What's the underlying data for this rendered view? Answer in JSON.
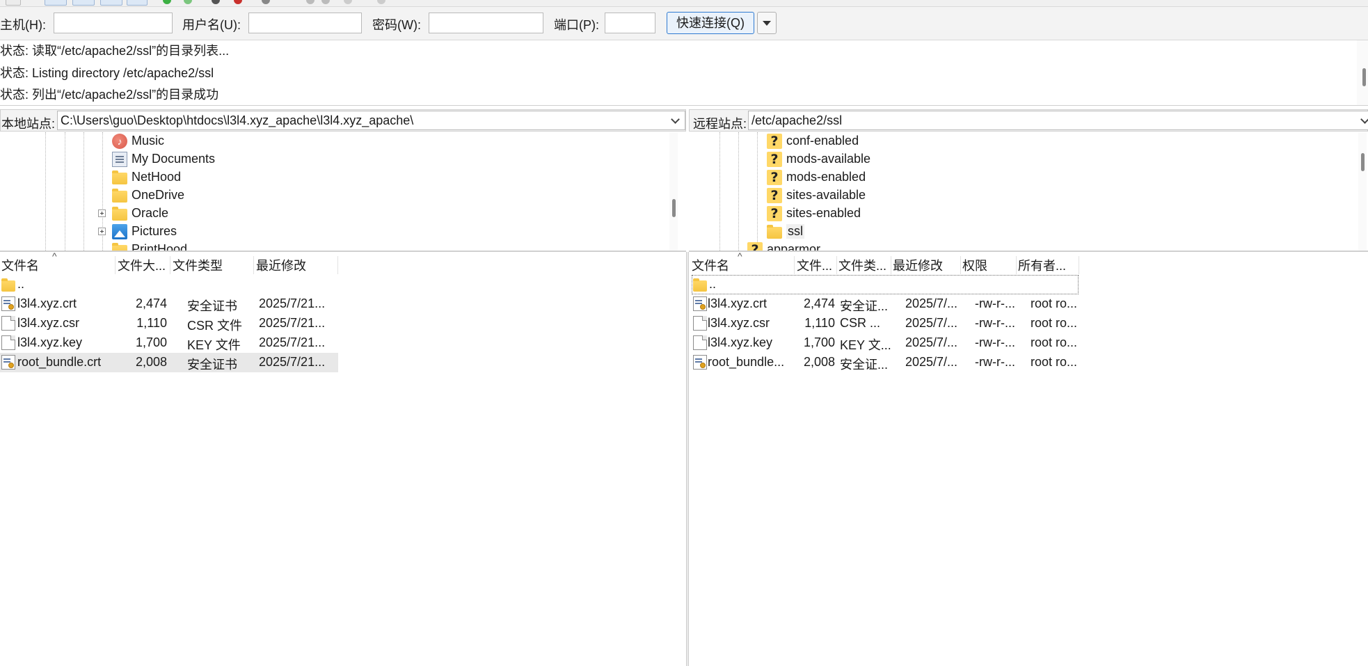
{
  "quickconnect": {
    "host_label": "主机(H):",
    "host_value": "",
    "user_label": "用户名(U):",
    "user_value": "",
    "pass_label": "密码(W):",
    "pass_value": "",
    "port_label": "端口(P):",
    "port_value": "",
    "connect_label": "快速连接(Q)"
  },
  "log": [
    "状态: 读取“/etc/apache2/ssl”的目录列表...",
    "状态: Listing directory /etc/apache2/ssl",
    "状态: 列出“/etc/apache2/ssl”的目录成功"
  ],
  "local": {
    "site_label": "本地站点:",
    "path": "C:\\Users\\guo\\Desktop\\htdocs\\l3l4.xyz_apache\\l3l4.xyz_apache\\",
    "tree": [
      {
        "label": "Music",
        "icon": "music-icon",
        "expandable": false
      },
      {
        "label": "My Documents",
        "icon": "documents-icon",
        "expandable": false
      },
      {
        "label": "NetHood",
        "icon": "folder-icon",
        "expandable": false
      },
      {
        "label": "OneDrive",
        "icon": "folder-icon",
        "expandable": false
      },
      {
        "label": "Oracle",
        "icon": "folder-icon",
        "expandable": true
      },
      {
        "label": "Pictures",
        "icon": "pictures-icon",
        "expandable": true
      },
      {
        "label": "PrintHood",
        "icon": "folder-icon",
        "expandable": false
      }
    ],
    "columns": [
      "文件名",
      "文件大...",
      "文件类型",
      "最近修改"
    ],
    "files": [
      {
        "name": "..",
        "size": "",
        "type": "",
        "modified": "",
        "icon": "folder-icon"
      },
      {
        "name": "l3l4.xyz.crt",
        "size": "2,474",
        "type": "安全证书",
        "modified": "2025/7/21...",
        "icon": "certificate-icon"
      },
      {
        "name": "l3l4.xyz.csr",
        "size": "1,110",
        "type": "CSR 文件",
        "modified": "2025/7/21...",
        "icon": "file-icon"
      },
      {
        "name": "l3l4.xyz.key",
        "size": "1,700",
        "type": "KEY 文件",
        "modified": "2025/7/21...",
        "icon": "file-icon"
      },
      {
        "name": "root_bundle.crt",
        "size": "2,008",
        "type": "安全证书",
        "modified": "2025/7/21...",
        "icon": "certificate-icon"
      }
    ]
  },
  "remote": {
    "site_label": "远程站点:",
    "path": "/etc/apache2/ssl",
    "tree": [
      {
        "label": "conf-enabled",
        "icon": "question-folder-icon"
      },
      {
        "label": "mods-available",
        "icon": "question-folder-icon"
      },
      {
        "label": "mods-enabled",
        "icon": "question-folder-icon"
      },
      {
        "label": "sites-available",
        "icon": "question-folder-icon"
      },
      {
        "label": "sites-enabled",
        "icon": "question-folder-icon"
      },
      {
        "label": "ssl",
        "icon": "folder-icon"
      },
      {
        "label": "apparmor",
        "icon": "question-folder-icon"
      }
    ],
    "columns": [
      "文件名",
      "文件...",
      "文件类...",
      "最近修改",
      "权限",
      "所有者..."
    ],
    "files": [
      {
        "name": "..",
        "size": "",
        "type": "",
        "modified": "",
        "perm": "",
        "owner": "",
        "icon": "folder-icon"
      },
      {
        "name": "l3l4.xyz.crt",
        "size": "2,474",
        "type": "安全证...",
        "modified": "2025/7/...",
        "perm": "-rw-r-...",
        "owner": "root ro...",
        "icon": "certificate-icon"
      },
      {
        "name": "l3l4.xyz.csr",
        "size": "1,110",
        "type": "CSR ...",
        "modified": "2025/7/...",
        "perm": "-rw-r-...",
        "owner": "root ro...",
        "icon": "file-icon"
      },
      {
        "name": "l3l4.xyz.key",
        "size": "1,700",
        "type": "KEY 文...",
        "modified": "2025/7/...",
        "perm": "-rw-r-...",
        "owner": "root ro...",
        "icon": "file-icon"
      },
      {
        "name": "root_bundle...",
        "size": "2,008",
        "type": "安全证...",
        "modified": "2025/7/...",
        "perm": "-rw-r-...",
        "owner": "root ro...",
        "icon": "certificate-icon"
      }
    ]
  }
}
